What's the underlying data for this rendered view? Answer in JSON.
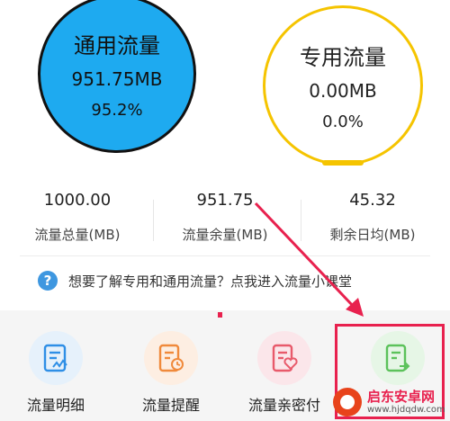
{
  "circles": {
    "general": {
      "title": "通用流量",
      "value": "951.75MB",
      "percent": "95.2%"
    },
    "special": {
      "title": "专用流量",
      "value": "0.00MB",
      "percent": "0.0%"
    }
  },
  "stats": [
    {
      "value": "1000.00",
      "label": "流量总量(MB)"
    },
    {
      "value": "951.75",
      "label": "流量余量(MB)"
    },
    {
      "value": "45.32",
      "label": "剩余日均(MB)"
    }
  ],
  "help": {
    "text": "想要了解专用和通用流量？点我进入流量小课堂"
  },
  "tiles": [
    {
      "label": "流量明细",
      "color": "#2f8fe6",
      "bg": "#e6f1fb",
      "icon": "usage-detail-icon"
    },
    {
      "label": "流量提醒",
      "color": "#f08a3c",
      "bg": "#fdeee2",
      "icon": "reminder-icon"
    },
    {
      "label": "流量亲密付",
      "color": "#e85a6b",
      "bg": "#fbe6ea",
      "icon": "family-pay-icon"
    },
    {
      "label": "",
      "color": "#5cc25b",
      "bg": "#e6f6e6",
      "icon": "share-icon"
    }
  ],
  "colors": {
    "primary_circle": "#1eaaf0",
    "special_ring": "#f5c400",
    "annotation": "#e8214e"
  },
  "watermark": {
    "name": "启东安卓网",
    "url": "www.hjdqdw.com"
  }
}
